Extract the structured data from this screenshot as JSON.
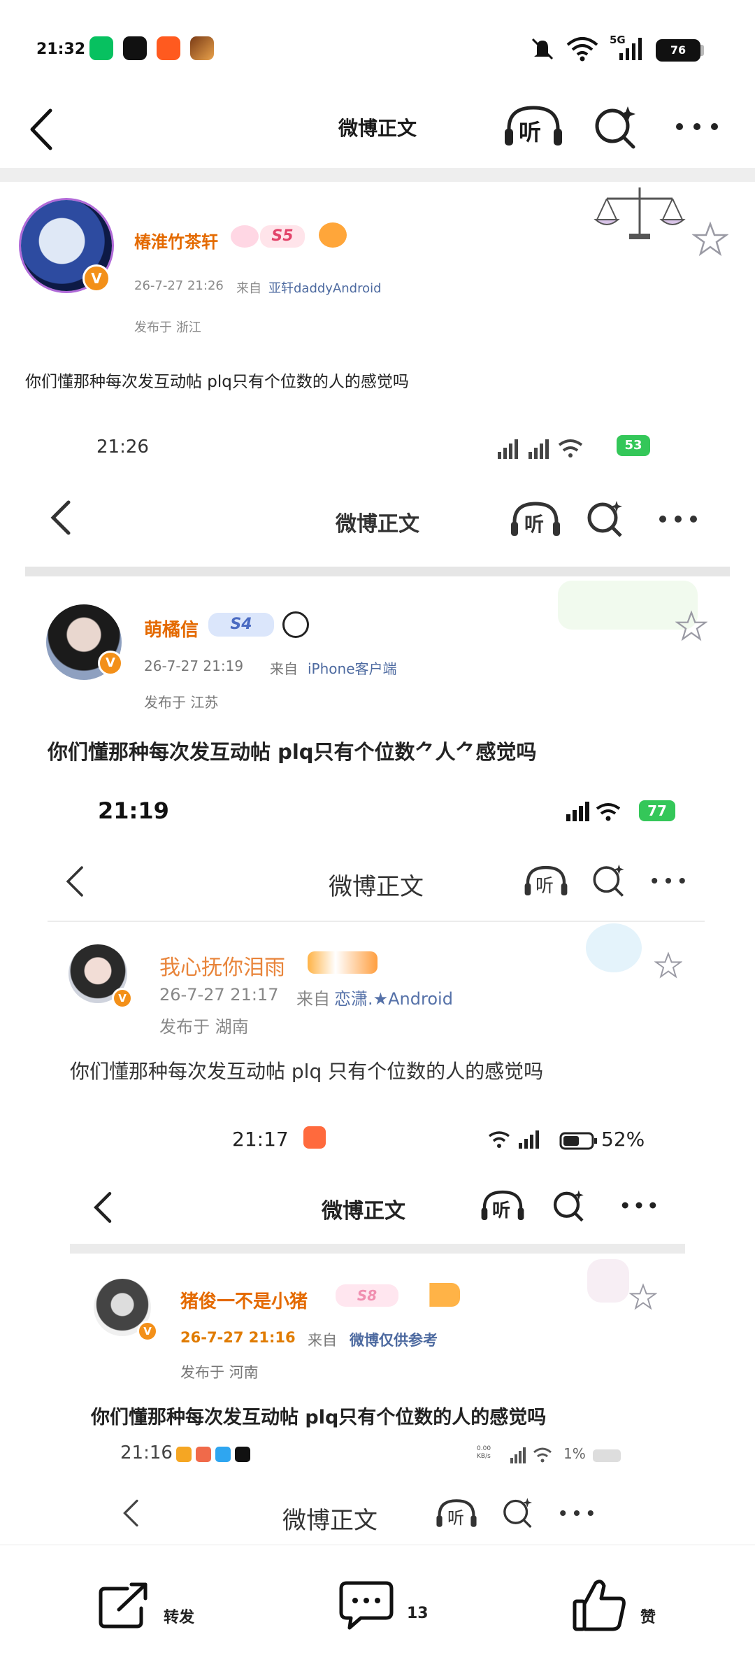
{
  "status_bar": {
    "time": "21:32",
    "battery": "76",
    "network": "5G"
  },
  "header": {
    "title": "微博正文",
    "listen_label": "听"
  },
  "post": {
    "author": "椿淮竹茶轩",
    "level_badge": "S5",
    "date": "26-7-27 21:26",
    "source_prefix": "来自",
    "source": "亚轩daddyAndroid",
    "location": "发布于 浙江",
    "text": "你们懂那种每次发互动帖 plq只有个位数的人的感觉吗"
  },
  "embed1": {
    "status_time": "21:26",
    "battery": "53",
    "title": "微博正文",
    "listen_label": "听",
    "author": "萌橘信",
    "level_badge": "S4",
    "date": "26-7-27  21:19",
    "source_prefix": "来自",
    "source": "iPhone客户端",
    "location": "发布于  江苏",
    "text": "你们懂那种每次发互动帖  plq只有个位数⺈人⺈感觉吗"
  },
  "embed2": {
    "status_time": "21:19",
    "battery": "77",
    "title": "微博正文",
    "listen_label": "听",
    "author": "我心抚你泪雨",
    "date": "26-7-27 21:17",
    "source_prefix": "来自",
    "source": "恋潇.★Android",
    "location": "发布于 湖南",
    "text": "你们懂那种每次发互动帖 plq 只有个位数的人的感觉吗"
  },
  "embed3": {
    "status_time": "21:17",
    "battery": "52%",
    "title": "微博正文",
    "listen_label": "听",
    "author": "猪俊一不是小猪",
    "level_badge": "S8",
    "date": "26-7-27  21:16",
    "source_prefix": "来自",
    "source": "微博仅供参考",
    "location": "发布于  河南",
    "text": "你们懂那种每次发互动帖  plq只有个位数的人的感觉吗"
  },
  "embed4": {
    "status_time": "21:16",
    "battery": "1%",
    "net_speed": "0.00 KB/s",
    "title": "微博正文",
    "listen_label": "听"
  },
  "bottom_bar": {
    "repost_label": "转发",
    "comment_count": "13",
    "like_label": "赞"
  },
  "colors": {
    "nickname": "#e46a00",
    "source_link": "#4d6aa0",
    "verified_badge": "#f39019"
  }
}
